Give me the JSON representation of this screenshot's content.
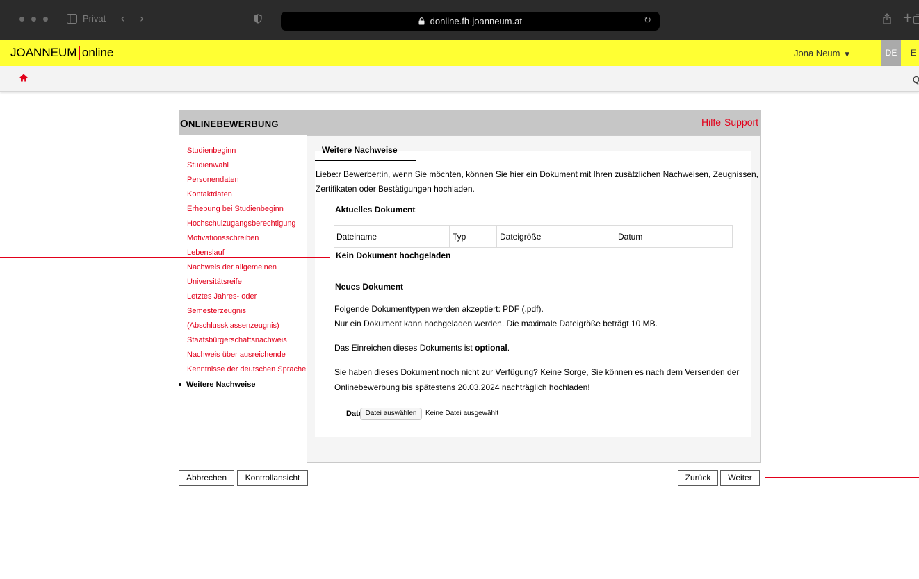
{
  "browser": {
    "tab_label": "Privat",
    "url": "donline.fh-joanneum.at"
  },
  "header": {
    "brand_left": "JOANNEUM",
    "brand_right": "online",
    "user": "Jona Neum",
    "lang_active": "DE",
    "lang_other": "E",
    "nav_trunc": "Q"
  },
  "page": {
    "title_first": "O",
    "title_rest": "NLINEBEWERBUNG",
    "help": "Hilfe",
    "support": "Support"
  },
  "sidebar": {
    "items": [
      "Studienbeginn",
      "Studienwahl",
      "Personendaten",
      "Kontaktdaten",
      "Erhebung bei Studienbeginn",
      "Hochschulzugangsberechtigung",
      "Motivationsschreiben",
      "Lebenslauf",
      "Nachweis der allgemeinen",
      "Universitätsreife",
      "Letztes Jahres- oder",
      "Semesterzeugnis",
      "(Abschlussklassenzeugnis)",
      "Staatsbürgerschaftsnachweis",
      "Nachweis über ausreichende",
      "Kenntnisse der deutschen Sprache"
    ],
    "current": "Weitere Nachweise"
  },
  "content": {
    "tab": "Weitere Nachweise",
    "intro_1": "Liebe:r Bewerber:in, wenn Sie möchten, können Sie hier ein Dokument mit Ihren zusätzlichen Nachweisen, Zeugnissen,",
    "intro_2": "Zertifikaten oder Bestätigungen hochladen.",
    "current_doc_heading": "Aktuelles Dokument",
    "table_headers": [
      "Dateiname",
      "Typ",
      "Dateigröße",
      "Datum"
    ],
    "no_doc": "Kein Dokument hochgeladen",
    "new_doc_heading": "Neues Dokument",
    "types_line": "Folgende Dokumenttypen werden akzeptiert: PDF (.pdf).",
    "size_line": "Nur ein Dokument kann hochgeladen werden. Die maximale Dateigröße beträgt 10 MB.",
    "optional_prefix": "Das Einreichen dieses Dokuments ist",
    "optional_word": "optional",
    "optional_suffix": ".",
    "later_1": "Sie haben dieses Dokument noch nicht zur Verfügung? Keine Sorge, Sie können es nach dem Versenden der",
    "later_2": "Onlinebewerbung bis spätestens 20.03.2024 nachträglich hochladen!",
    "file_label": "Datei",
    "file_button": "Datei auswählen",
    "file_status": "Keine Datei ausgewählt"
  },
  "footer": {
    "cancel": "Abbrechen",
    "preview": "Kontrollansicht",
    "back": "Zurück",
    "next": "Weiter"
  },
  "colors": {
    "accent_red": "#e2001a",
    "header_yellow": "#ffff33"
  }
}
